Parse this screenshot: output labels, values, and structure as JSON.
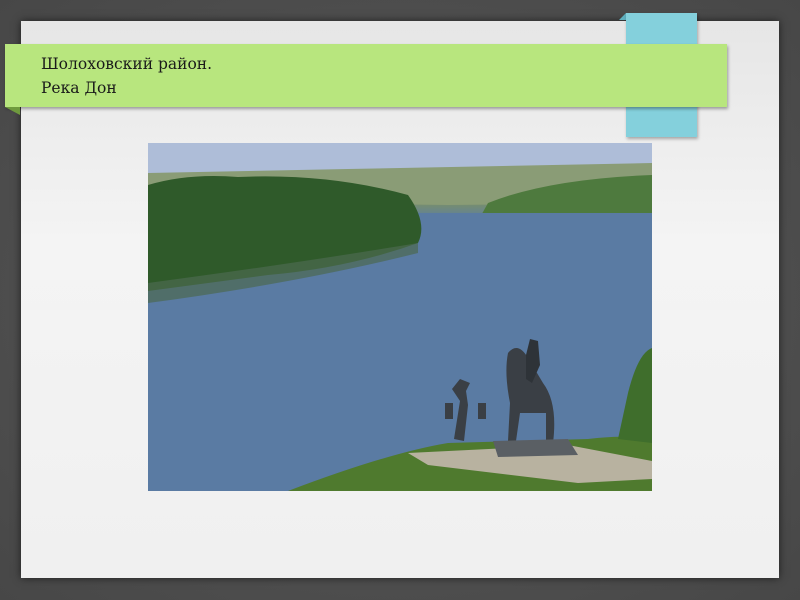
{
  "slide": {
    "title_line1": "Шолоховский район.",
    "title_line2": "Река Дон"
  },
  "colors": {
    "banner": "#b8e67e",
    "tab": "#84d0dc",
    "background": "#4f4f4f"
  },
  "photo": {
    "subject": "river-landscape-with-monument"
  }
}
